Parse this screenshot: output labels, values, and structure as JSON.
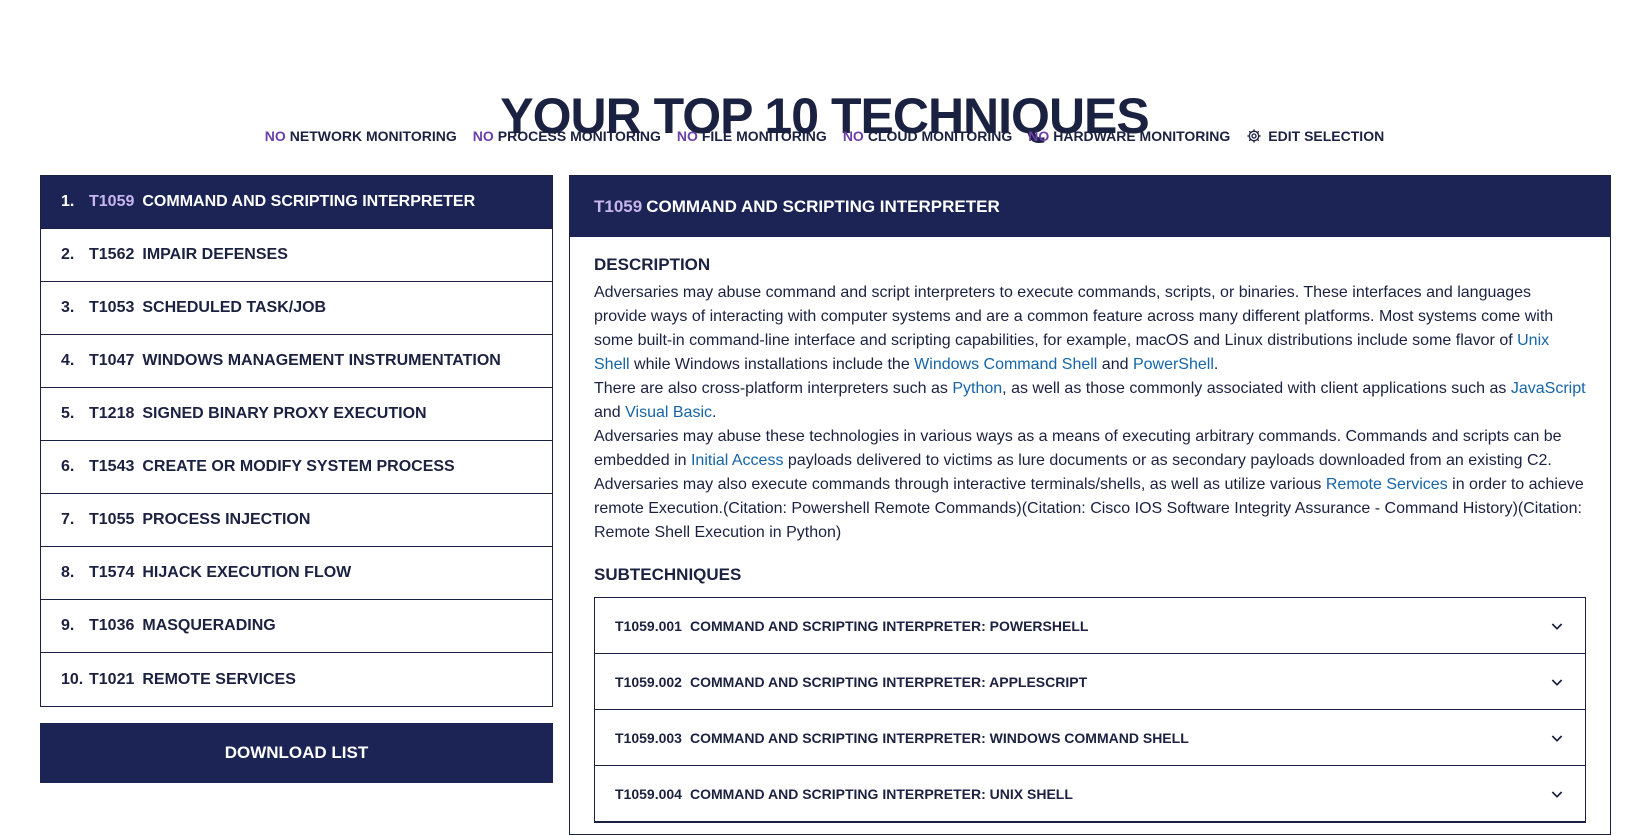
{
  "page": {
    "title": "YOUR TOP 10 TECHNIQUES"
  },
  "filters": [
    {
      "no": "NO",
      "label": "NETWORK MONITORING"
    },
    {
      "no": "NO",
      "label": "PROCESS MONITORING"
    },
    {
      "no": "NO",
      "label": "FILE MONITORING"
    },
    {
      "no": "NO",
      "label": "CLOUD MONITORING"
    },
    {
      "no": "NO",
      "label": "HARDWARE MONITORING"
    }
  ],
  "edit_selection": {
    "label": "EDIT SELECTION",
    "icon": "gear-icon"
  },
  "techniques": [
    {
      "num": "1.",
      "id": "T1059",
      "name": "COMMAND AND SCRIPTING INTERPRETER"
    },
    {
      "num": "2.",
      "id": "T1562",
      "name": "IMPAIR DEFENSES"
    },
    {
      "num": "3.",
      "id": "T1053",
      "name": "SCHEDULED TASK/JOB"
    },
    {
      "num": "4.",
      "id": "T1047",
      "name": "WINDOWS MANAGEMENT INSTRUMENTATION"
    },
    {
      "num": "5.",
      "id": "T1218",
      "name": "SIGNED BINARY PROXY EXECUTION"
    },
    {
      "num": "6.",
      "id": "T1543",
      "name": "CREATE OR MODIFY SYSTEM PROCESS"
    },
    {
      "num": "7.",
      "id": "T1055",
      "name": "PROCESS INJECTION"
    },
    {
      "num": "8.",
      "id": "T1574",
      "name": "HIJACK EXECUTION FLOW"
    },
    {
      "num": "9.",
      "id": "T1036",
      "name": "MASQUERADING"
    },
    {
      "num": "10.",
      "id": "T1021",
      "name": "REMOTE SERVICES"
    }
  ],
  "download": {
    "label": "DOWNLOAD LIST"
  },
  "detail": {
    "id": "T1059",
    "name": "COMMAND AND SCRIPTING INTERPRETER",
    "description_title": "DESCRIPTION",
    "description": {
      "p1a": "Adversaries may abuse command and script interpreters to execute commands, scripts, or binaries. These interfaces and languages provide ways of interacting with computer systems and are a common feature across many different platforms. Most systems come with some built-in command-line interface and scripting capabilities, for example, macOS and Linux distributions include some flavor of ",
      "link_unix": "Unix Shell",
      "p1b": " while Windows installations include the ",
      "link_wcs": "Windows Command Shell",
      "p1c": " and ",
      "link_ps": "PowerShell",
      "p1d": ".",
      "p2a": "There are also cross-platform interpreters such as ",
      "link_python": "Python",
      "p2b": ", as well as those commonly associated with client applications such as ",
      "link_js": "JavaScript",
      "p2c": " and ",
      "link_vb": "Visual Basic",
      "p2d": ".",
      "p3a": "Adversaries may abuse these technologies in various ways as a means of executing arbitrary commands. Commands and scripts can be embedded in ",
      "link_ia": "Initial Access",
      "p3b": " payloads delivered to victims as lure documents or as secondary payloads downloaded from an existing C2. Adversaries may also execute commands through interactive terminals/shells, as well as utilize various ",
      "link_rs": "Remote Services",
      "p3c": " in order to achieve remote Execution.(Citation: Powershell Remote Commands)(Citation: Cisco IOS Software Integrity Assurance - Command History)(Citation: Remote Shell Execution in Python)"
    },
    "subtechniques_title": "SUBTECHNIQUES",
    "subtechniques": [
      {
        "id": "T1059.001",
        "name": "COMMAND AND SCRIPTING INTERPRETER: POWERSHELL"
      },
      {
        "id": "T1059.002",
        "name": "COMMAND AND SCRIPTING INTERPRETER: APPLESCRIPT"
      },
      {
        "id": "T1059.003",
        "name": "COMMAND AND SCRIPTING INTERPRETER: WINDOWS COMMAND SHELL"
      },
      {
        "id": "T1059.004",
        "name": "COMMAND AND SCRIPTING INTERPRETER: UNIX SHELL"
      }
    ]
  },
  "colors": {
    "navy": "#1b2454",
    "accent_purple": "#6b3fa8",
    "link_blue": "#1565a8"
  }
}
